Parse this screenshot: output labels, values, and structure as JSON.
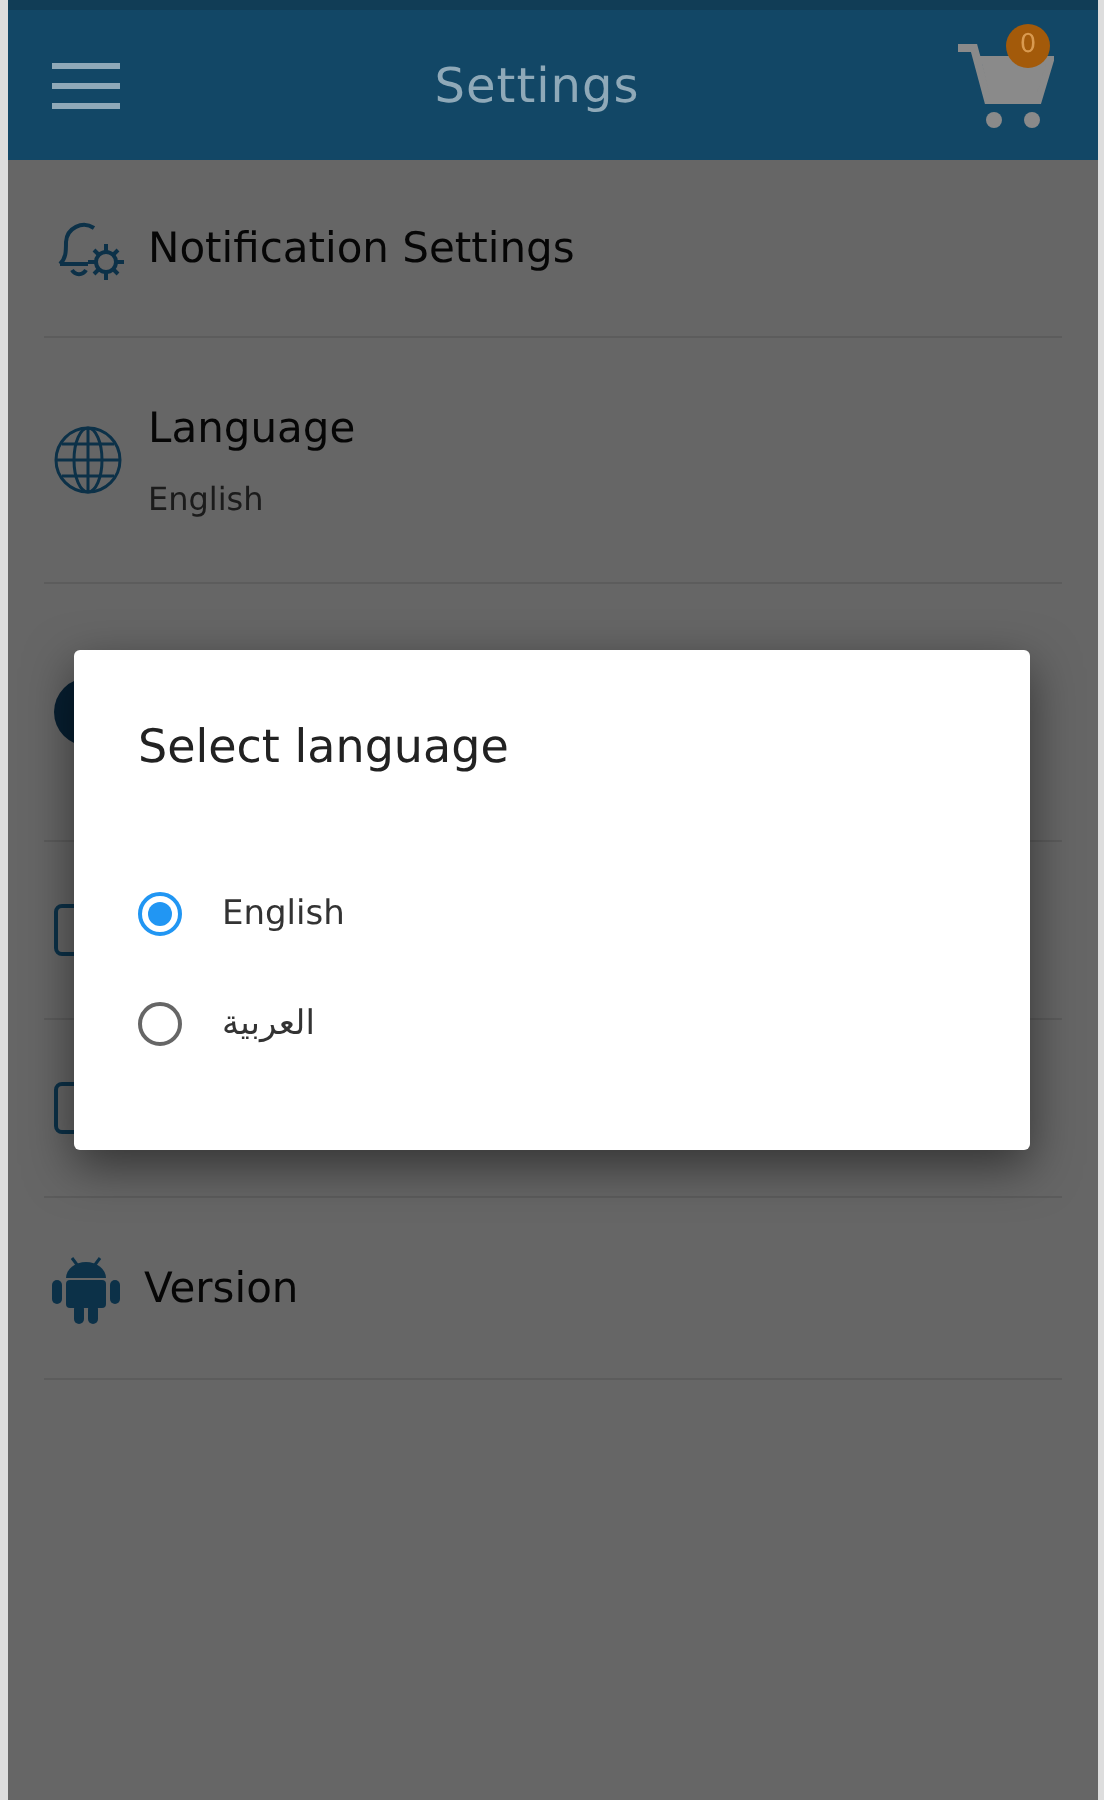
{
  "app_bar": {
    "title": "Settings",
    "cart_count": "0"
  },
  "settings": [
    {
      "kind": "notifications",
      "label": "Notification Settings"
    },
    {
      "kind": "language",
      "label": "Language",
      "value": "English"
    },
    {
      "kind": "circle"
    },
    {
      "kind": "square"
    },
    {
      "kind": "square"
    },
    {
      "kind": "android",
      "label": "Version"
    }
  ],
  "dialog": {
    "title": "Select language",
    "options": [
      {
        "label": "English",
        "selected": true
      },
      {
        "label": "العربية",
        "selected": false
      }
    ]
  }
}
